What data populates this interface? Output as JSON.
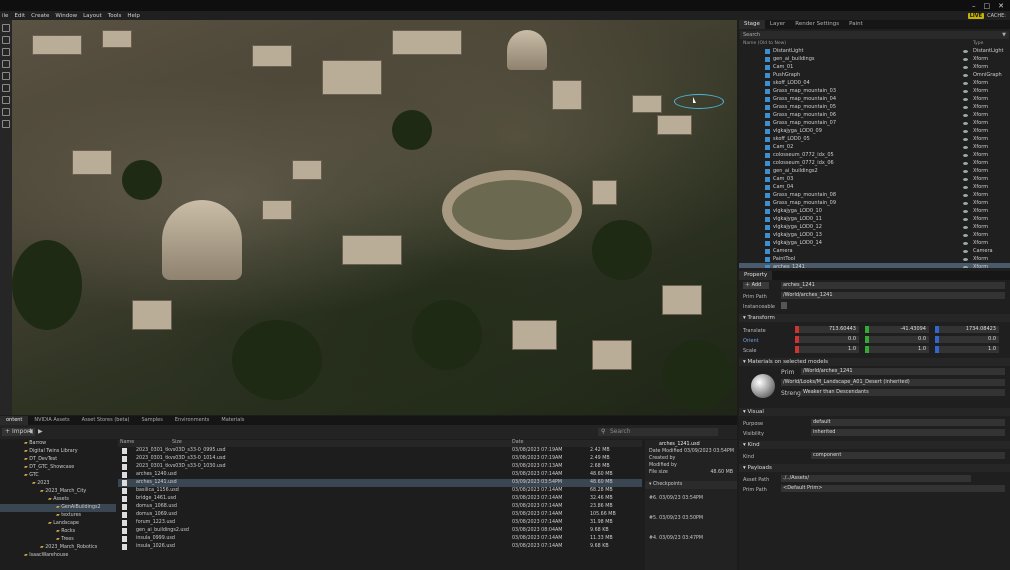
{
  "menubar": [
    "ile",
    "Edit",
    "Create",
    "Window",
    "Layout",
    "Tools",
    "Help"
  ],
  "status": {
    "live": "LIVE",
    "cache": "CACHE:"
  },
  "window_controls": [
    "–",
    "□",
    "✕"
  ],
  "right_tabs": [
    "Stage",
    "Layer",
    "Render Settings",
    "Paint"
  ],
  "stage": {
    "search_placeholder": "Search",
    "col_name": "Name (Old to New)",
    "col_type": "Type",
    "rows": [
      {
        "name": "DistantLight",
        "type": "DistantLight"
      },
      {
        "name": "gen_ai_buildings",
        "type": "Xform"
      },
      {
        "name": "Cam_01",
        "type": "Xform"
      },
      {
        "name": "PushGraph",
        "type": "OmniGraph"
      },
      {
        "name": "skoff_LOD0_04",
        "type": "Xform"
      },
      {
        "name": "Grass_map_mountain_03",
        "type": "Xform"
      },
      {
        "name": "Grass_map_mountain_04",
        "type": "Xform"
      },
      {
        "name": "Grass_map_mountain_05",
        "type": "Xform"
      },
      {
        "name": "Grass_map_mountain_06",
        "type": "Xform"
      },
      {
        "name": "Grass_map_mountain_07",
        "type": "Xform"
      },
      {
        "name": "vlgkajyga_LOD0_09",
        "type": "Xform"
      },
      {
        "name": "skoff_LOD0_05",
        "type": "Xform"
      },
      {
        "name": "Cam_02",
        "type": "Xform"
      },
      {
        "name": "colosseum_0772_idx_05",
        "type": "Xform"
      },
      {
        "name": "colosseum_0772_idx_06",
        "type": "Xform"
      },
      {
        "name": "gen_ai_buildings2",
        "type": "Xform"
      },
      {
        "name": "Cam_03",
        "type": "Xform"
      },
      {
        "name": "Cam_04",
        "type": "Xform"
      },
      {
        "name": "Grass_map_mountain_08",
        "type": "Xform"
      },
      {
        "name": "Grass_map_mountain_09",
        "type": "Xform"
      },
      {
        "name": "vlgkajyga_LOD0_10",
        "type": "Xform"
      },
      {
        "name": "vlgkajyga_LOD0_11",
        "type": "Xform"
      },
      {
        "name": "vlgkajyga_LOD0_12",
        "type": "Xform"
      },
      {
        "name": "vlgkajyga_LOD0_13",
        "type": "Xform"
      },
      {
        "name": "vlgkajyga_LOD0_14",
        "type": "Xform"
      },
      {
        "name": "Camera",
        "type": "Camera"
      },
      {
        "name": "PaintTool",
        "type": "Xform"
      },
      {
        "name": "arches_1241",
        "type": "Xform"
      }
    ]
  },
  "property": {
    "tab": "Property",
    "add": "Add",
    "name_value": "arches_1241",
    "prim_path_label": "Prim Path",
    "prim_path": "/World/arches_1241",
    "instanceable": "Instanceable",
    "transform": "Transform",
    "translate": "Translate",
    "t_x": "713.60443",
    "t_y": "-41.43094",
    "t_z": "1734.08423",
    "orient": "Orient",
    "o_x": "0.0",
    "o_y": "0.0",
    "o_z": "0.0",
    "scale": "Scale",
    "s_x": "1.0",
    "s_y": "1.0",
    "s_z": "1.0",
    "materials": "Materials on selected models",
    "prim": "Prim",
    "prim_value": "/World/arches_1241",
    "material_value": "/World/Looks/M_Landscape_A01_Desert (inherited)",
    "strength_label": "Strength",
    "strength_value": "Weaker than Descendants",
    "visual": "Visual",
    "purpose": "Purpose",
    "purpose_value": "default",
    "visibility": "Visibility",
    "visibility_value": "inherited",
    "kind_section": "Kind",
    "kind": "Kind",
    "kind_value": "component",
    "payloads": "Payloads",
    "asset_path": "Asset Path",
    "asset_value": "./../Assets/",
    "prim_path2": "Prim Path",
    "prim_value2": "<Default Prim>"
  },
  "bottom_tabs": [
    "ontent",
    "NVIDIA Assets",
    "Asset Stores (beta)",
    "Samples",
    "Environments",
    "Materials"
  ],
  "import": "Import",
  "search_placeholder": "Search",
  "tree": [
    {
      "label": "Barrow"
    },
    {
      "label": "Digital Twins Library"
    },
    {
      "label": "DT_DevTest"
    },
    {
      "label": "DT_GTC_Showcase"
    },
    {
      "label": "GTC"
    },
    {
      "label": "2023"
    },
    {
      "label": "2023_March_City"
    },
    {
      "label": "Assets"
    },
    {
      "label": "GenAiBuildings2"
    },
    {
      "label": "textures"
    },
    {
      "label": "Landscape"
    },
    {
      "label": "Rocks"
    },
    {
      "label": "Trees"
    },
    {
      "label": "2023_March_Robotics"
    },
    {
      "label": "IsaacWarehouse"
    }
  ],
  "files": {
    "col_name": "Name",
    "col_date": "Date",
    "col_size": "Size",
    "rows": [
      {
        "name": "2023_0301_tkvs03D_s33-0_0995.usd",
        "date": "03/08/2023 07:19AM",
        "size": "2.42 MB"
      },
      {
        "name": "2023_0301_tkvs03D_s33-0_1014.usd",
        "date": "03/08/2023 07:19AM",
        "size": "2.49 MB"
      },
      {
        "name": "2023_0301_tkvs03D_s33-0_1030.usd",
        "date": "03/08/2023 07:13AM",
        "size": "2.68 MB"
      },
      {
        "name": "arches_1240.usd",
        "date": "03/08/2023 07:14AM",
        "size": "48.60 MB"
      },
      {
        "name": "arches_1241.usd",
        "date": "03/09/2023 03:54PM",
        "size": "48.60 MB"
      },
      {
        "name": "basilica_1156.usd",
        "date": "03/08/2023 07:14AM",
        "size": "68.28 MB"
      },
      {
        "name": "bridge_1461.usd",
        "date": "03/08/2023 07:14AM",
        "size": "32.46 MB"
      },
      {
        "name": "domus_1068.usd",
        "date": "03/08/2023 07:14AM",
        "size": "23.86 MB"
      },
      {
        "name": "domus_1069.usd",
        "date": "03/08/2023 07:14AM",
        "size": "105.66 MB"
      },
      {
        "name": "forum_1223.usd",
        "date": "03/08/2023 07:14AM",
        "size": "31.98 MB"
      },
      {
        "name": "gen_ai_buildings2.usd",
        "date": "03/08/2023 08:04AM",
        "size": "9.68 KB"
      },
      {
        "name": "insula_0999.usd",
        "date": "03/08/2023 07:14AM",
        "size": "11.33 MB"
      },
      {
        "name": "insula_1026.usd",
        "date": "03/08/2023 07:14AM",
        "size": "9.68 KB"
      }
    ]
  },
  "details": {
    "file": "arches_1241.usd",
    "modified": "Date Modified 03/09/2023 03:54PM",
    "created": "Created by",
    "modified_by": "Modified by",
    "filesize_label": "File size",
    "filesize": "48.60 MB",
    "checkpoints": "Checkpoints",
    "cp1": "#6.  03/09/23 03:54PM",
    "cp2": "#5.  03/09/23 03:50PM",
    "cp3": "#4.  03/09/23 03:47PM"
  }
}
